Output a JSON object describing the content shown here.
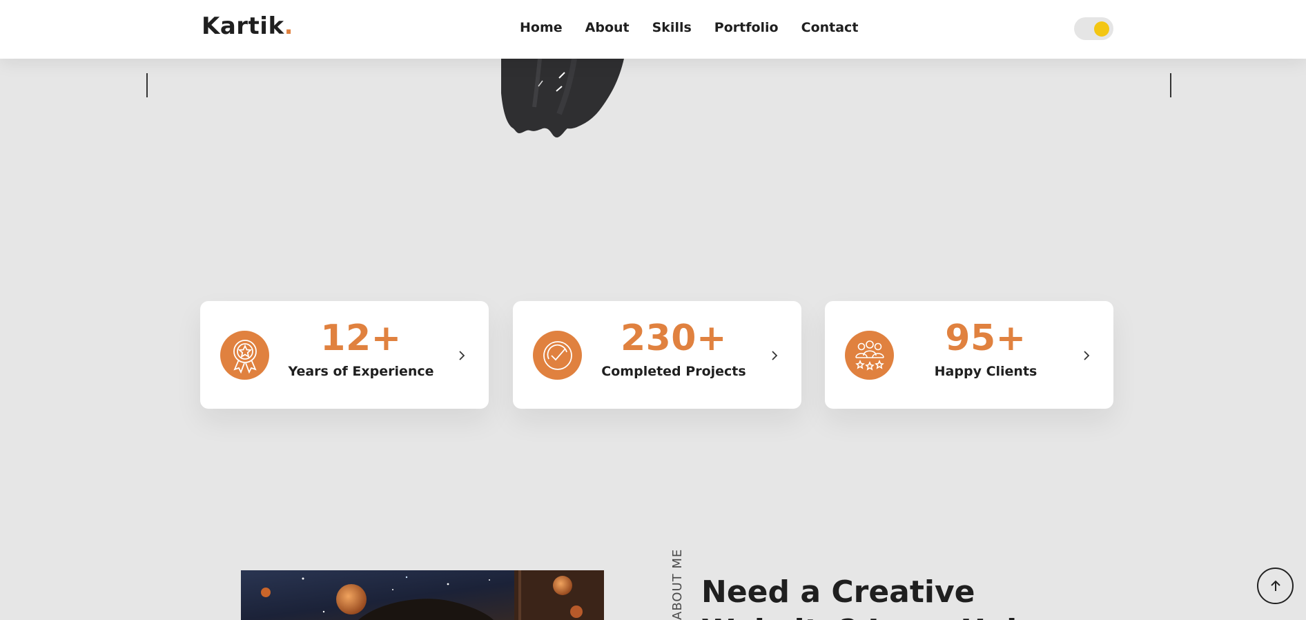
{
  "header": {
    "logo_text": "Kartik",
    "logo_dot": ".",
    "nav": [
      {
        "label": "Home"
      },
      {
        "label": "About"
      },
      {
        "label": "Skills"
      },
      {
        "label": "Portfolio"
      },
      {
        "label": "Contact"
      }
    ],
    "theme_toggle": {
      "knob_color": "#f3c613",
      "state": "on"
    }
  },
  "stats": [
    {
      "value": "12+",
      "label": "Years of Experience",
      "icon": "award-ribbon-icon"
    },
    {
      "value": "230+",
      "label": "Completed Projects",
      "icon": "check-badge-icon"
    },
    {
      "value": "95+",
      "label": "Happy Clients",
      "icon": "clients-stars-icon"
    }
  ],
  "about": {
    "side_label": "ABOUT ME",
    "heading_line1": "Need a Creative",
    "heading_line2": "Website? I can Help"
  },
  "colors": {
    "accent": "#e0813f",
    "background": "#e6e6e6",
    "text": "#1f1f1f",
    "card": "#ffffff"
  },
  "icons": {
    "scroll_top": "arrow-up-icon",
    "card_chevron": "chevron-right-icon"
  }
}
